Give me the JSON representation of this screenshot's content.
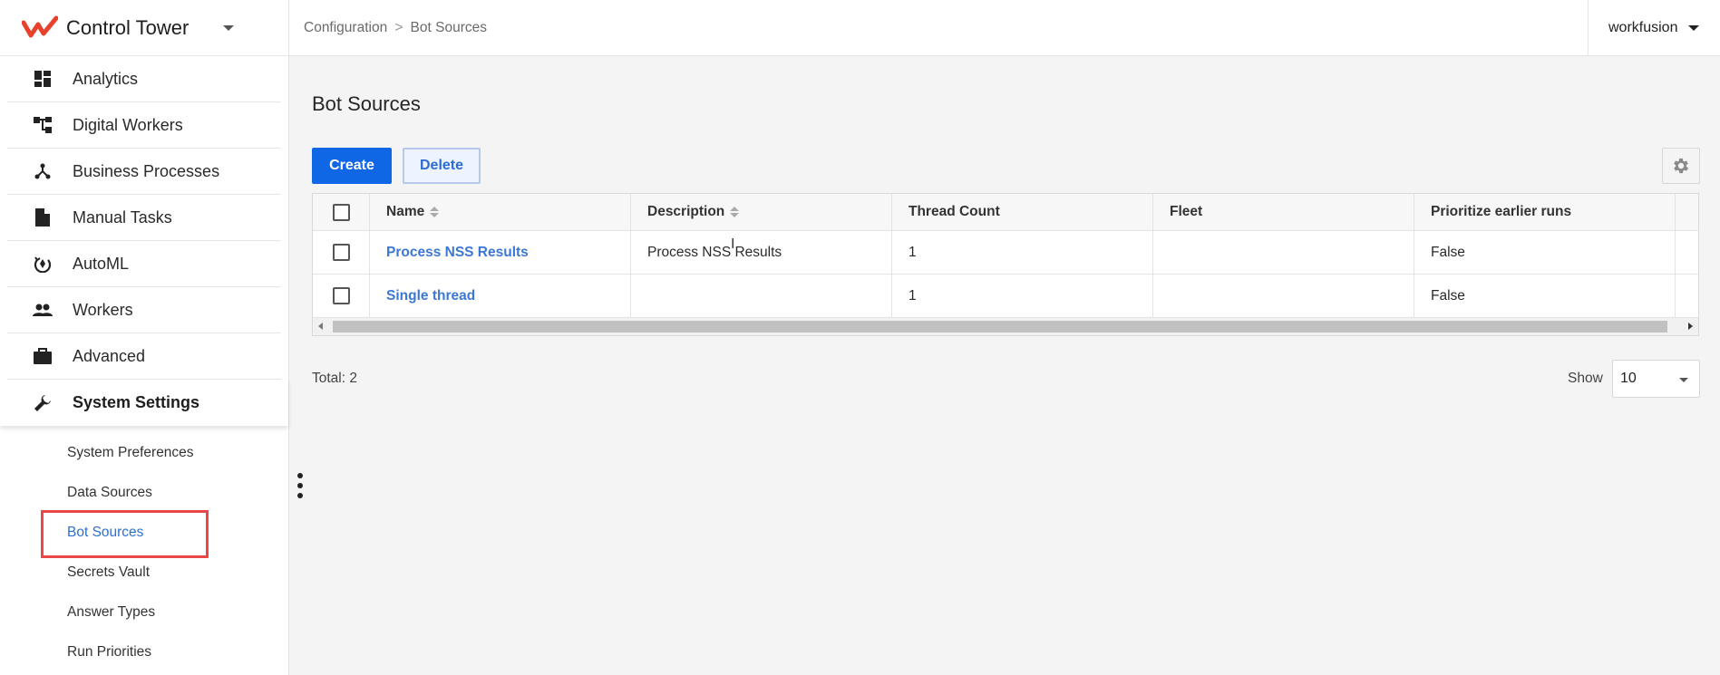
{
  "brand": {
    "title": "Control Tower"
  },
  "nav": [
    {
      "label": "Analytics",
      "icon": "dashboard-icon"
    },
    {
      "label": "Digital Workers",
      "icon": "hierarchy-icon"
    },
    {
      "label": "Business Processes",
      "icon": "process-icon"
    },
    {
      "label": "Manual Tasks",
      "icon": "document-icon"
    },
    {
      "label": "AutoML",
      "icon": "automl-icon"
    },
    {
      "label": "Workers",
      "icon": "people-icon"
    },
    {
      "label": "Advanced",
      "icon": "briefcase-icon"
    },
    {
      "label": "System Settings",
      "icon": "wrench-icon"
    }
  ],
  "subnav": [
    {
      "label": "System Preferences"
    },
    {
      "label": "Data Sources"
    },
    {
      "label": "Bot Sources"
    },
    {
      "label": "Secrets Vault"
    },
    {
      "label": "Answer Types"
    },
    {
      "label": "Run Priorities"
    }
  ],
  "breadcrumb": {
    "parent": "Configuration",
    "current": "Bot Sources",
    "separator": ">"
  },
  "user": {
    "name": "workfusion"
  },
  "page": {
    "title": "Bot Sources"
  },
  "toolbar": {
    "create_label": "Create",
    "delete_label": "Delete"
  },
  "table": {
    "columns": [
      "Name",
      "Description",
      "Thread Count",
      "Fleet",
      "Prioritize earlier runs"
    ],
    "rows": [
      {
        "name": "Process NSS Results",
        "description": "Process NSS Results",
        "thread_count": "1",
        "fleet": "",
        "prioritize": "False"
      },
      {
        "name": "Single thread",
        "description": "",
        "thread_count": "1",
        "fleet": "",
        "prioritize": "False"
      }
    ]
  },
  "footer": {
    "total": "Total: 2",
    "show_label": "Show",
    "page_size": "10"
  },
  "colors": {
    "primary": "#1067e6",
    "link": "#3b78d6",
    "highlight": "#e94848",
    "brand": "#e8412c"
  }
}
